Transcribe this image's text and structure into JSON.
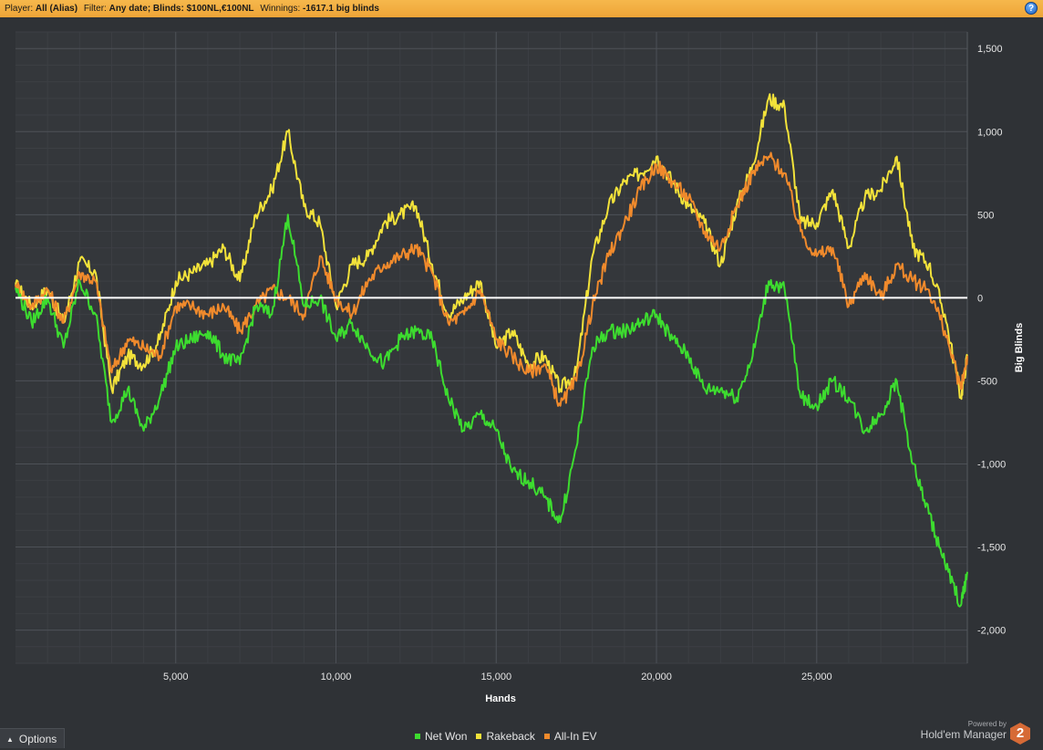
{
  "header": {
    "player_label": "Player:",
    "player_value": "All (Alias)",
    "filter_label": "Filter:",
    "filter_value": "Any date; Blinds: $100NL,€100NL",
    "winnings_label": "Winnings:",
    "winnings_value": "-1617.1 big blinds",
    "help_icon": "?"
  },
  "options": {
    "label": "Options",
    "icon": "caret-up-icon"
  },
  "brand": {
    "powered_by": "Powered by",
    "name": "Hold'em Manager",
    "logo_text": "2"
  },
  "legend": [
    {
      "name": "Net Won",
      "color": "#3ddc2f"
    },
    {
      "name": "Rakeback",
      "color": "#f2e23a"
    },
    {
      "name": "All-In EV",
      "color": "#f08a2c"
    }
  ],
  "chart_data": {
    "type": "line",
    "xlabel": "Hands",
    "ylabel": "Big Blinds",
    "xlim": [
      0,
      29700
    ],
    "ylim": [
      -2200,
      1600
    ],
    "x_ticks": [
      5000,
      10000,
      15000,
      20000,
      25000
    ],
    "x_tick_labels": [
      "5,000",
      "10,000",
      "15,000",
      "20,000",
      "25,000"
    ],
    "y_ticks": [
      1500,
      1000,
      500,
      0,
      -500,
      -1000,
      -1500,
      -2000
    ],
    "y_tick_labels": [
      "1,500",
      "1,000",
      "500",
      "0",
      "-500",
      "-1,000",
      "-1,500",
      "-2,000"
    ],
    "grid": true,
    "zero_line": true,
    "legend_position": "bottom-center",
    "series": [
      {
        "name": "Rakeback",
        "color": "#f2e23a",
        "x": [
          0,
          500,
          1000,
          1500,
          2000,
          2500,
          3000,
          3500,
          4000,
          4500,
          5000,
          5500,
          6000,
          6500,
          7000,
          7500,
          8000,
          8500,
          9000,
          9500,
          10000,
          10500,
          11000,
          11500,
          12000,
          12500,
          13000,
          13500,
          14000,
          14500,
          15000,
          15500,
          16000,
          16500,
          17000,
          17500,
          18000,
          18500,
          19000,
          19500,
          20000,
          20500,
          21000,
          21500,
          22000,
          22500,
          23000,
          23500,
          24000,
          24500,
          25000,
          25500,
          26000,
          26500,
          27000,
          27500,
          28000,
          28500,
          29000,
          29500,
          29700
        ],
        "y": [
          80,
          -50,
          50,
          -150,
          220,
          150,
          -550,
          -350,
          -400,
          -250,
          100,
          150,
          200,
          300,
          100,
          500,
          650,
          1000,
          550,
          450,
          -50,
          200,
          250,
          450,
          500,
          550,
          200,
          -100,
          0,
          100,
          -300,
          -200,
          -400,
          -350,
          -550,
          -450,
          250,
          550,
          700,
          750,
          850,
          700,
          550,
          450,
          200,
          550,
          800,
          1200,
          1150,
          450,
          450,
          650,
          300,
          600,
          650,
          850,
          300,
          200,
          -100,
          -600,
          -350
        ]
      },
      {
        "name": "All-In EV",
        "color": "#f08a2c",
        "x": [
          0,
          500,
          1000,
          1500,
          2000,
          2500,
          3000,
          3500,
          4000,
          4500,
          5000,
          5500,
          6000,
          6500,
          7000,
          7500,
          8000,
          8500,
          9000,
          9500,
          10000,
          10500,
          11000,
          11500,
          12000,
          12500,
          13000,
          13500,
          14000,
          14500,
          15000,
          15500,
          16000,
          16500,
          17000,
          17500,
          18000,
          18500,
          19000,
          19500,
          20000,
          20500,
          21000,
          21500,
          22000,
          22500,
          23000,
          23500,
          24000,
          24500,
          25000,
          25500,
          26000,
          26500,
          27000,
          27500,
          28000,
          28500,
          29000,
          29500,
          29700
        ],
        "y": [
          80,
          -50,
          50,
          -150,
          150,
          100,
          -450,
          -250,
          -300,
          -350,
          -50,
          -50,
          -100,
          -50,
          -200,
          -50,
          50,
          0,
          -100,
          250,
          0,
          -100,
          100,
          200,
          250,
          300,
          150,
          -150,
          -100,
          50,
          -250,
          -350,
          -450,
          -400,
          -650,
          -500,
          -50,
          250,
          450,
          650,
          800,
          700,
          600,
          400,
          300,
          550,
          750,
          850,
          750,
          400,
          250,
          300,
          -50,
          150,
          0,
          200,
          100,
          50,
          -200,
          -550,
          -350
        ]
      },
      {
        "name": "Net Won",
        "color": "#3ddc2f",
        "x": [
          0,
          500,
          1000,
          1500,
          2000,
          2500,
          3000,
          3500,
          4000,
          4500,
          5000,
          5500,
          6000,
          6500,
          7000,
          7500,
          8000,
          8500,
          9000,
          9500,
          10000,
          10500,
          11000,
          11500,
          12000,
          12500,
          13000,
          13500,
          14000,
          14500,
          15000,
          15500,
          16000,
          16500,
          17000,
          17500,
          18000,
          18500,
          19000,
          19500,
          20000,
          20500,
          21000,
          21500,
          22000,
          22500,
          23000,
          23500,
          24000,
          24500,
          25000,
          25500,
          26000,
          26500,
          27000,
          27500,
          28000,
          28500,
          29000,
          29500,
          29700
        ],
        "y": [
          60,
          -150,
          0,
          -300,
          100,
          -100,
          -750,
          -550,
          -800,
          -600,
          -300,
          -250,
          -200,
          -350,
          -400,
          -50,
          -100,
          500,
          -50,
          0,
          -250,
          -150,
          -300,
          -400,
          -250,
          -200,
          -250,
          -600,
          -800,
          -700,
          -800,
          -1050,
          -1100,
          -1200,
          -1350,
          -900,
          -300,
          -200,
          -200,
          -150,
          -100,
          -250,
          -350,
          -550,
          -550,
          -600,
          -350,
          100,
          50,
          -600,
          -650,
          -500,
          -600,
          -800,
          -700,
          -500,
          -1000,
          -1300,
          -1600,
          -1850,
          -1650
        ]
      }
    ]
  }
}
